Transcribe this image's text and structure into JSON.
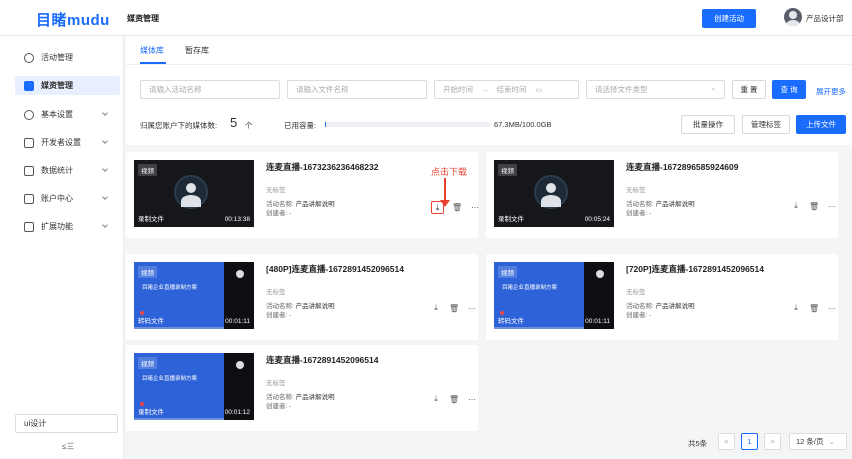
{
  "brand": {
    "logo_a": "目睹",
    "logo_b": "mudu"
  },
  "header": {
    "breadcrumb": "媒资管理",
    "create_button": "创建活动",
    "user_name": "产品设计部"
  },
  "sidebar": {
    "items": [
      {
        "label": "活动管理",
        "icon": "globe-icon",
        "expandable": false
      },
      {
        "label": "媒资管理",
        "icon": "media-icon",
        "expandable": false,
        "active": true
      },
      {
        "label": "基本设置",
        "icon": "settings-icon",
        "expandable": true
      },
      {
        "label": "开发者设置",
        "icon": "developer-icon",
        "expandable": true
      },
      {
        "label": "数据统计",
        "icon": "chart-icon",
        "expandable": true
      },
      {
        "label": "账户中心",
        "icon": "account-icon",
        "expandable": true
      },
      {
        "label": "扩展功能",
        "icon": "apps-icon",
        "expandable": true
      }
    ],
    "workspace": "ui设计",
    "collapse_icon": "≤三"
  },
  "tabs": [
    {
      "label": "媒体库",
      "active": true
    },
    {
      "label": "暂存库",
      "active": false
    }
  ],
  "filters": {
    "activity_placeholder": "请输入活动名称",
    "file_placeholder": "请输入文件名称",
    "start_placeholder": "开始时间",
    "range_arrow": "→",
    "end_placeholder": "结束时间",
    "type_placeholder": "请选择文件类型",
    "reset_label": "重 置",
    "query_label": "查 询",
    "more_label": "展开更多"
  },
  "stats": {
    "media_count_label": "归属您账户下的媒体数:",
    "media_count": "5",
    "media_unit": "个",
    "usage_label": "已用容量:",
    "usage_value": "67.3MB/100.0GB",
    "usage_fraction": 0.000673
  },
  "actions": {
    "batch": "批量操作",
    "manage_tags": "管理标签",
    "upload": "上传文件"
  },
  "cards": [
    {
      "type_tag": "视频",
      "thumb_style": "avatar",
      "bottom_label": "录制文件",
      "duration": "00:13:38",
      "title": "连麦直播-1673236236468232",
      "tag_text": "无标签",
      "activity_label": "活动名称:",
      "activity_name": "产品讲解说明",
      "creator_label": "创建者:",
      "creator": "-"
    },
    {
      "type_tag": "视频",
      "thumb_style": "avatar",
      "bottom_label": "录制文件",
      "duration": "00:05:24",
      "title": "连麦直播-1672896585924609",
      "tag_text": "无标签",
      "activity_label": "活动名称:",
      "activity_name": "产品讲解说明",
      "creator_label": "创建者:",
      "creator": "-"
    },
    {
      "type_tag": "视频",
      "thumb_style": "slide",
      "slide_text": "目睹企业直播录制方案",
      "bottom_label": "转码文件",
      "duration": "00:01:11",
      "title": "[480P]连麦直播-1672891452096514",
      "tag_text": "无标签",
      "activity_label": "活动名称:",
      "activity_name": "产品讲解说明",
      "creator_label": "创建者:",
      "creator": "-"
    },
    {
      "type_tag": "视频",
      "thumb_style": "slide",
      "slide_text": "目睹企业直播录制方案",
      "bottom_label": "转码文件",
      "duration": "00:01:11",
      "title": "[720P]连麦直播-1672891452096514",
      "tag_text": "无标签",
      "activity_label": "活动名称:",
      "activity_name": "产品讲解说明",
      "creator_label": "创建者:",
      "creator": "-"
    },
    {
      "type_tag": "视频",
      "thumb_style": "slide",
      "slide_text": "目睹企业直播录制方案",
      "bottom_label": "录制文件",
      "duration": "00:01:12",
      "title": "连麦直播-1672891452096514",
      "tag_text": "无标签",
      "activity_label": "活动名称:",
      "activity_name": "产品讲解说明",
      "creator_label": "创建者:",
      "creator": "-"
    }
  ],
  "annotation": {
    "text": "点击下载",
    "color": "#e8412f"
  },
  "pagination": {
    "total": "共5条",
    "prev": "<",
    "current": "1",
    "next": ">",
    "page_size": "12 条/页"
  },
  "colors": {
    "accent": "#1a6cff",
    "annotation": "#e8412f"
  }
}
